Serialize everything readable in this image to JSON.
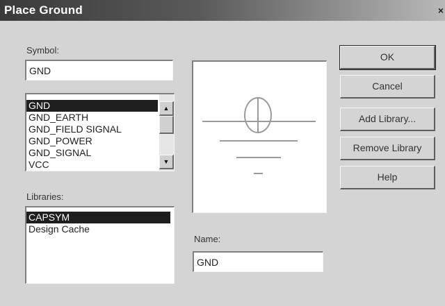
{
  "window": {
    "title": "Place Ground",
    "close_glyph": "×"
  },
  "symbol": {
    "label": "Symbol:",
    "value": "GND",
    "items": [
      "GND",
      "GND_EARTH",
      "GND_FIELD SIGNAL",
      "GND_POWER",
      "GND_SIGNAL",
      "VCC"
    ],
    "selected": "GND"
  },
  "libraries": {
    "label": "Libraries:",
    "items": [
      "CAPSYM",
      "Design Cache"
    ],
    "selected": "CAPSYM"
  },
  "name": {
    "label": "Name:",
    "value": "GND"
  },
  "buttons": {
    "ok": "OK",
    "cancel": "Cancel",
    "add_library": "Add Library...",
    "remove_library": "Remove Library",
    "help": "Help"
  },
  "scrollbar": {
    "up_icon": "▲",
    "down_icon": "▼"
  },
  "colors": {
    "selection": "#1e1e1e",
    "symbol_stroke": "#9a9a9a"
  }
}
